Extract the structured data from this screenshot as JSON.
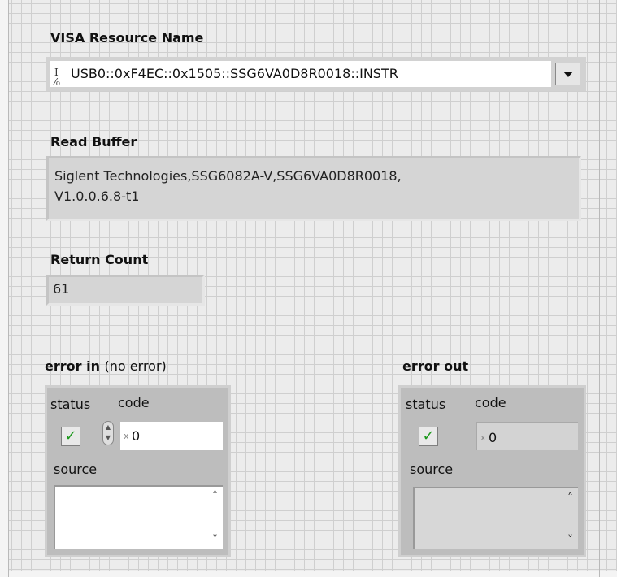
{
  "visa": {
    "label": "VISA Resource Name",
    "io_symbol": "I/0",
    "value": "USB0::0xF4EC::0x1505::SSG6VA0D8R0018::INSTR"
  },
  "read_buffer": {
    "label": "Read Buffer",
    "line1": "Siglent Technologies,SSG6082A-V,SSG6VA0D8R0018,",
    "line2": "V1.0.0.6.8-t1"
  },
  "return_count": {
    "label": "Return Count",
    "value": "61"
  },
  "error_in": {
    "label": "error in",
    "sublabel": "(no error)",
    "status_label": "status",
    "code_label": "code",
    "code_value": "0",
    "source_label": "source",
    "source_value": ""
  },
  "error_out": {
    "label": "error out",
    "status_label": "status",
    "code_label": "code",
    "code_value": "0",
    "source_label": "source",
    "source_value": ""
  },
  "colors": {
    "check_green": "#1f9a1f",
    "indicator_gray": "#d5d5d5",
    "cluster_gray": "#bdbdbd"
  }
}
